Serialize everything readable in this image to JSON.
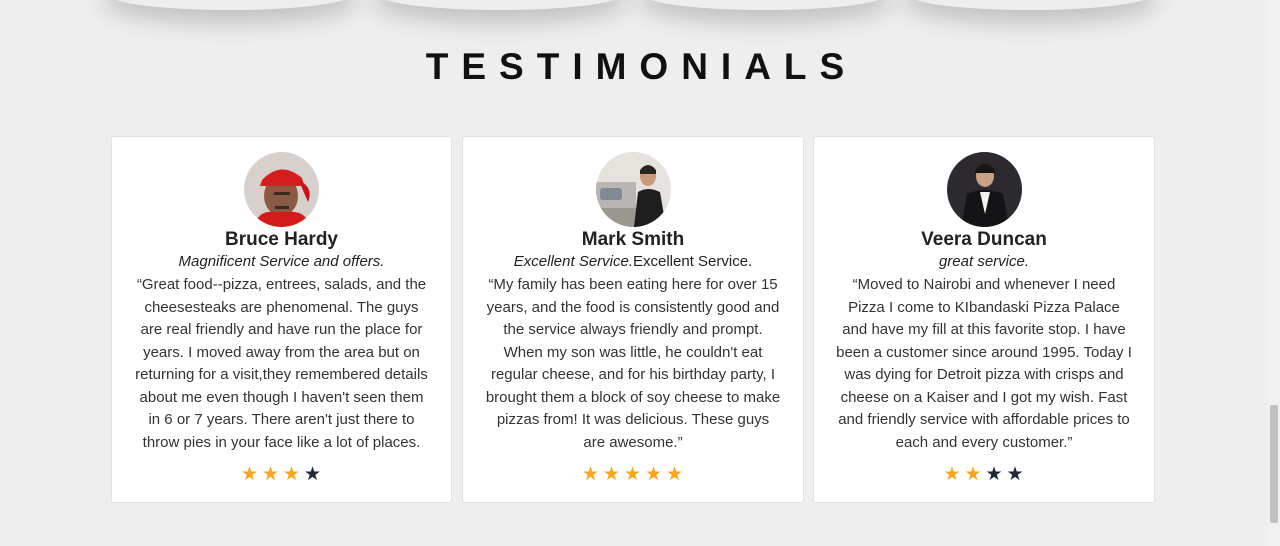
{
  "section": {
    "title": "TESTIMONIALS"
  },
  "testimonials": [
    {
      "name": "Bruce Hardy",
      "tagline_italic": "Magnificent Service and offers.",
      "tagline_plain": "",
      "quote": "“Great food--pizza, entrees, salads, and the cheesesteaks are phenomenal. The guys are real friendly and have run the place for years. I moved away from the area but on returning for a visit,they remembered details about me even though I haven't seen them in 6 or 7 years. There aren't just there to throw pies in your face like a lot of places.",
      "rating": 3,
      "max_rating": 4
    },
    {
      "name": "Mark Smith",
      "tagline_italic": "Excellent Service.",
      "tagline_plain": "Excellent Service.",
      "quote": "“My family has been eating here for over 15 years, and the food is consistently good and the service always friendly and prompt. When my son was little, he couldn't eat regular cheese, and for his birthday party, I brought them a block of soy cheese to make pizzas from! It was delicious. These guys are awesome.”",
      "rating": 5,
      "max_rating": 5
    },
    {
      "name": "Veera Duncan",
      "tagline_italic": "great service.",
      "tagline_plain": "",
      "quote": "“Moved to Nairobi and whenever I need Pizza I come to KIbandaski Pizza Palace and have my fill at this favorite stop. I have been a customer since around 1995. Today I was dying for Detroit pizza with crisps and cheese on a Kaiser and I got my wish. Fast and friendly service with affordable prices to each and every customer.”",
      "rating": 2,
      "max_rating": 4
    }
  ],
  "colors": {
    "star_on": "#f5a623",
    "star_off": "#1f2a36",
    "background": "#eeeeee"
  }
}
